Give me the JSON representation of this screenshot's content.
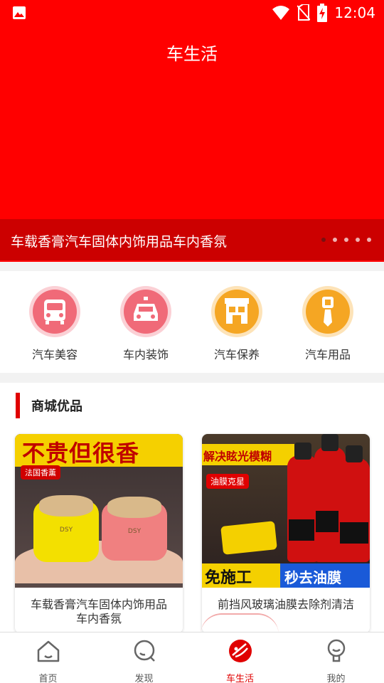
{
  "status_bar": {
    "time": "12:04",
    "icons": [
      "image-icon",
      "wifi-icon",
      "no-sim-icon",
      "battery-charging-icon"
    ]
  },
  "hero": {
    "title": "车生活",
    "caption": "车载香膏汽车固体内饰用品车内香氛",
    "slides_total": 5,
    "active_slide": 1
  },
  "categories": [
    {
      "label": "汽车美容",
      "icon": "bus-icon",
      "color": "#f06a78"
    },
    {
      "label": "车内装饰",
      "icon": "car-icon",
      "color": "#f06a78"
    },
    {
      "label": "汽车保养",
      "icon": "garage-icon",
      "color": "#f5a623"
    },
    {
      "label": "汽车用品",
      "icon": "tie-icon",
      "color": "#f5a623"
    }
  ],
  "shop": {
    "title": "商城优品",
    "products": [
      {
        "name": "车载香膏汽车固体内饰用品车内香氛",
        "banner": "不贵但很香",
        "tag": "法国香薰",
        "jar_label": "DSY"
      },
      {
        "name": "前挡风玻璃油膜去除剂清洁",
        "banner": "解决眩光模糊",
        "tag": "油膜克星",
        "bottom_left": "免施工",
        "bottom_right": "秒去油膜"
      }
    ]
  },
  "tabbar": {
    "tabs": [
      {
        "label": "首页",
        "icon": "home-icon"
      },
      {
        "label": "发现",
        "icon": "discover-icon"
      },
      {
        "label": "车生活",
        "icon": "car-life-icon"
      },
      {
        "label": "我的",
        "icon": "profile-icon"
      }
    ],
    "active": "车生活",
    "accent": "#e00000"
  }
}
